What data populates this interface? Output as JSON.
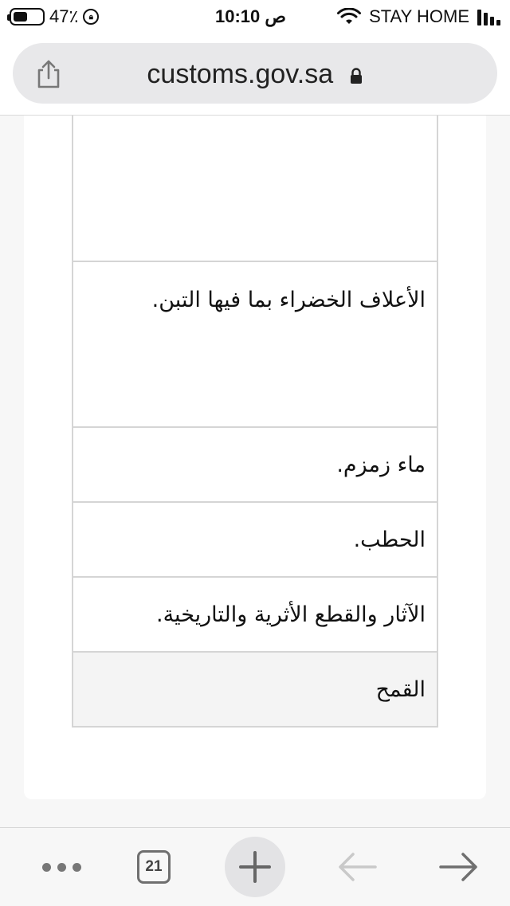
{
  "status_bar": {
    "battery_percent": "47٪",
    "battery_level": 0.47,
    "time": "10:10 ص",
    "carrier": "STAY HOME",
    "icons": [
      "battery-icon",
      "rotation-lock-icon",
      "wifi-icon",
      "signal-icon"
    ]
  },
  "browser": {
    "url": "customs.gov.sa",
    "secure": true,
    "icons": [
      "share-icon",
      "lock-icon"
    ]
  },
  "table": {
    "rows": [
      {
        "text": ""
      },
      {
        "text": "الأعلاف الخضراء بما فيها التبن."
      },
      {
        "text": "ماء زمزم."
      },
      {
        "text": "الحطب."
      },
      {
        "text": "الآثار والقطع الأثرية والتاريخية."
      },
      {
        "text": "القمح"
      }
    ]
  },
  "toolbar": {
    "tab_count": "21",
    "icons": [
      "more-icon",
      "tabs-icon",
      "plus-icon",
      "back-arrow-icon",
      "forward-arrow-icon"
    ]
  },
  "colors": {
    "url_pill": "#e8e8ea",
    "table_border": "#d5d5d5",
    "highlight_row": "#f4f4f4",
    "disabled_arrow": "#c9c9c9",
    "enabled_arrow": "#6f6f6f"
  }
}
